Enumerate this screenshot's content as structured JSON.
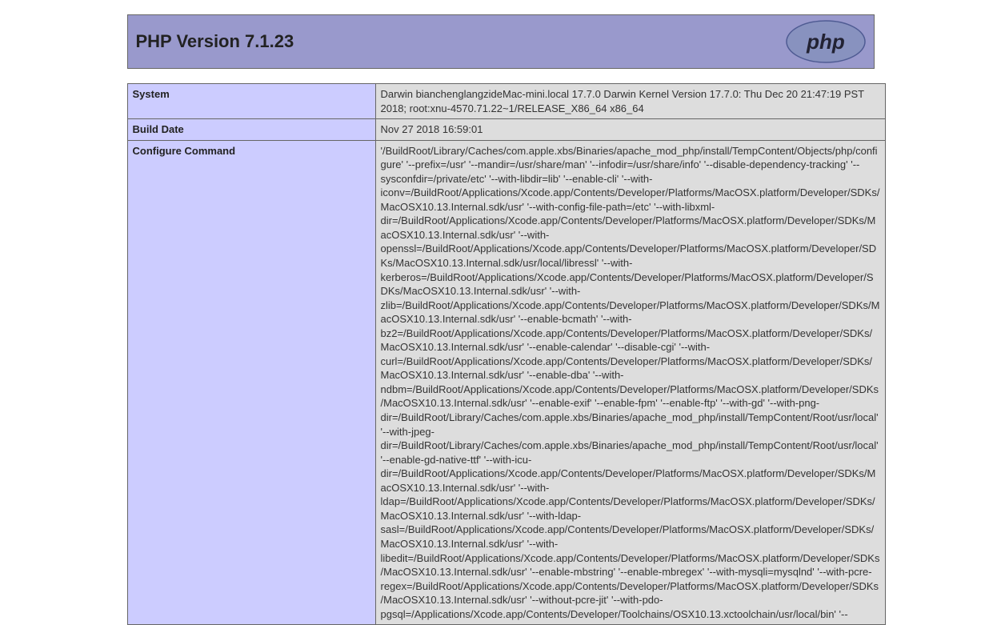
{
  "header": {
    "title": "PHP Version 7.1.23"
  },
  "rows": [
    {
      "label": "System",
      "value": "Darwin bianchenglangzideMac-mini.local 17.7.0 Darwin Kernel Version 17.7.0: Thu Dec 20 21:47:19 PST 2018; root:xnu-4570.71.22~1/RELEASE_X86_64 x86_64"
    },
    {
      "label": "Build Date",
      "value": "Nov 27 2018 16:59:01"
    },
    {
      "label": "Configure Command",
      "value": " '/BuildRoot/Library/Caches/com.apple.xbs/Binaries/apache_mod_php/install/TempContent/Objects/php/configure' '--prefix=/usr' '--mandir=/usr/share/man' '--infodir=/usr/share/info' '--disable-dependency-tracking' '--sysconfdir=/private/etc' '--with-libdir=lib' '--enable-cli' '--with-iconv=/BuildRoot/Applications/Xcode.app/Contents/Developer/Platforms/MacOSX.platform/Developer/SDKs/MacOSX10.13.Internal.sdk/usr' '--with-config-file-path=/etc' '--with-libxml-dir=/BuildRoot/Applications/Xcode.app/Contents/Developer/Platforms/MacOSX.platform/Developer/SDKs/MacOSX10.13.Internal.sdk/usr' '--with-openssl=/BuildRoot/Applications/Xcode.app/Contents/Developer/Platforms/MacOSX.platform/Developer/SDKs/MacOSX10.13.Internal.sdk/usr/local/libressl' '--with-kerberos=/BuildRoot/Applications/Xcode.app/Contents/Developer/Platforms/MacOSX.platform/Developer/SDKs/MacOSX10.13.Internal.sdk/usr' '--with-zlib=/BuildRoot/Applications/Xcode.app/Contents/Developer/Platforms/MacOSX.platform/Developer/SDKs/MacOSX10.13.Internal.sdk/usr' '--enable-bcmath' '--with-bz2=/BuildRoot/Applications/Xcode.app/Contents/Developer/Platforms/MacOSX.platform/Developer/SDKs/MacOSX10.13.Internal.sdk/usr' '--enable-calendar' '--disable-cgi' '--with-curl=/BuildRoot/Applications/Xcode.app/Contents/Developer/Platforms/MacOSX.platform/Developer/SDKs/MacOSX10.13.Internal.sdk/usr' '--enable-dba' '--with-ndbm=/BuildRoot/Applications/Xcode.app/Contents/Developer/Platforms/MacOSX.platform/Developer/SDKs/MacOSX10.13.Internal.sdk/usr' '--enable-exif' '--enable-fpm' '--enable-ftp' '--with-gd' '--with-png-dir=/BuildRoot/Library/Caches/com.apple.xbs/Binaries/apache_mod_php/install/TempContent/Root/usr/local' '--with-jpeg-dir=/BuildRoot/Library/Caches/com.apple.xbs/Binaries/apache_mod_php/install/TempContent/Root/usr/local' '--enable-gd-native-ttf' '--with-icu-dir=/BuildRoot/Applications/Xcode.app/Contents/Developer/Platforms/MacOSX.platform/Developer/SDKs/MacOSX10.13.Internal.sdk/usr' '--with-ldap=/BuildRoot/Applications/Xcode.app/Contents/Developer/Platforms/MacOSX.platform/Developer/SDKs/MacOSX10.13.Internal.sdk/usr' '--with-ldap-sasl=/BuildRoot/Applications/Xcode.app/Contents/Developer/Platforms/MacOSX.platform/Developer/SDKs/MacOSX10.13.Internal.sdk/usr' '--with-libedit=/BuildRoot/Applications/Xcode.app/Contents/Developer/Platforms/MacOSX.platform/Developer/SDKs/MacOSX10.13.Internal.sdk/usr' '--enable-mbstring' '--enable-mbregex' '--with-mysqli=mysqlnd' '--with-pcre-regex=/BuildRoot/Applications/Xcode.app/Contents/Developer/Platforms/MacOSX.platform/Developer/SDKs/MacOSX10.13.Internal.sdk/usr' '--without-pcre-jit' '--with-pdo-pgsql=/Applications/Xcode.app/Contents/Developer/Toolchains/OSX10.13.xctoolchain/usr/local/bin' '--"
    }
  ]
}
